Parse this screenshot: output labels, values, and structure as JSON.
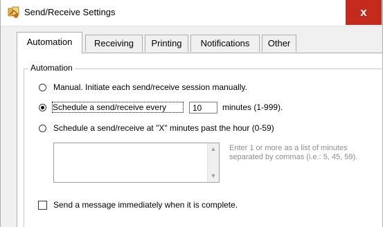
{
  "window": {
    "title": "Send/Receive Settings",
    "close_label": "x"
  },
  "tabs": [
    {
      "label": "Automation",
      "active": true
    },
    {
      "label": "Receiving",
      "active": false
    },
    {
      "label": "Printing",
      "active": false
    },
    {
      "label": "Notifications",
      "active": false
    },
    {
      "label": "Other",
      "active": false
    }
  ],
  "group": {
    "legend": "Automation"
  },
  "options": {
    "manual": {
      "label": "Manual.  Initiate each send/receive session manually.",
      "selected": false
    },
    "every": {
      "label": "Schedule a send/receive every",
      "value": "10",
      "suffix": "minutes (1-999).",
      "selected": true
    },
    "past_hour": {
      "label": "Schedule a send/receive at \"X\" minutes past the hour (0-59)",
      "selected": false
    }
  },
  "minutes_list": {
    "items": [],
    "hint": "Enter 1 or more as a list of minutes separated by commas (i.e.: 5, 45, 59)."
  },
  "send_immediately": {
    "label": "Send a message immediately when it is complete.",
    "checked": false
  },
  "colors": {
    "close_button": "#c42b1c",
    "hint_text": "#8c8c8c"
  },
  "icons": {
    "app": "app-icon",
    "close": "close-icon",
    "scroll_up": "chevron-up-icon",
    "scroll_down": "chevron-down-icon"
  }
}
